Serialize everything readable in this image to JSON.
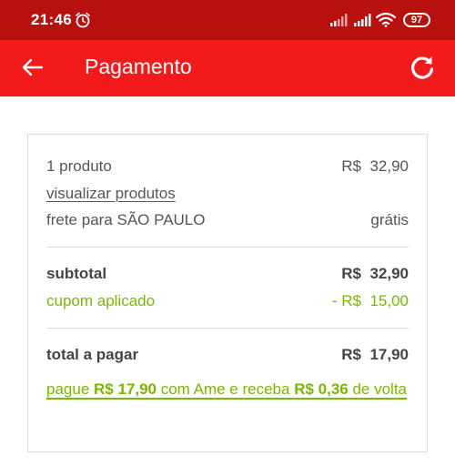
{
  "status_bar": {
    "time": "21:46",
    "battery": "97",
    "icons": [
      "alarm-icon",
      "signal-icon",
      "signal-icon",
      "wifi-icon",
      "battery-icon"
    ]
  },
  "app_bar": {
    "title": "Pagamento",
    "back_icon": "arrow-left-icon",
    "refresh_icon": "refresh-icon"
  },
  "summary": {
    "products_label": "1 produto",
    "products_value": "R$  32,90",
    "view_products_link": "visualizar produtos",
    "shipping_label": "frete para SÃO PAULO",
    "shipping_value": "grátis",
    "subtotal_label": "subtotal",
    "subtotal_value": "R$  32,90",
    "coupon_label": "cupom aplicado",
    "coupon_value": "- R$  15,00",
    "total_label": "total a pagar",
    "total_value": "R$  17,90"
  },
  "promo": {
    "part1": "pague ",
    "amount": "R$ 17,90",
    "part2": " com Ame e receba ",
    "cashback": "R$ 0,36",
    "part3": " de volta"
  },
  "colors": {
    "status_bar": "#b80f0f",
    "app_bar": "#f21a1a",
    "accent_green": "#7ab800",
    "text": "#555555"
  }
}
